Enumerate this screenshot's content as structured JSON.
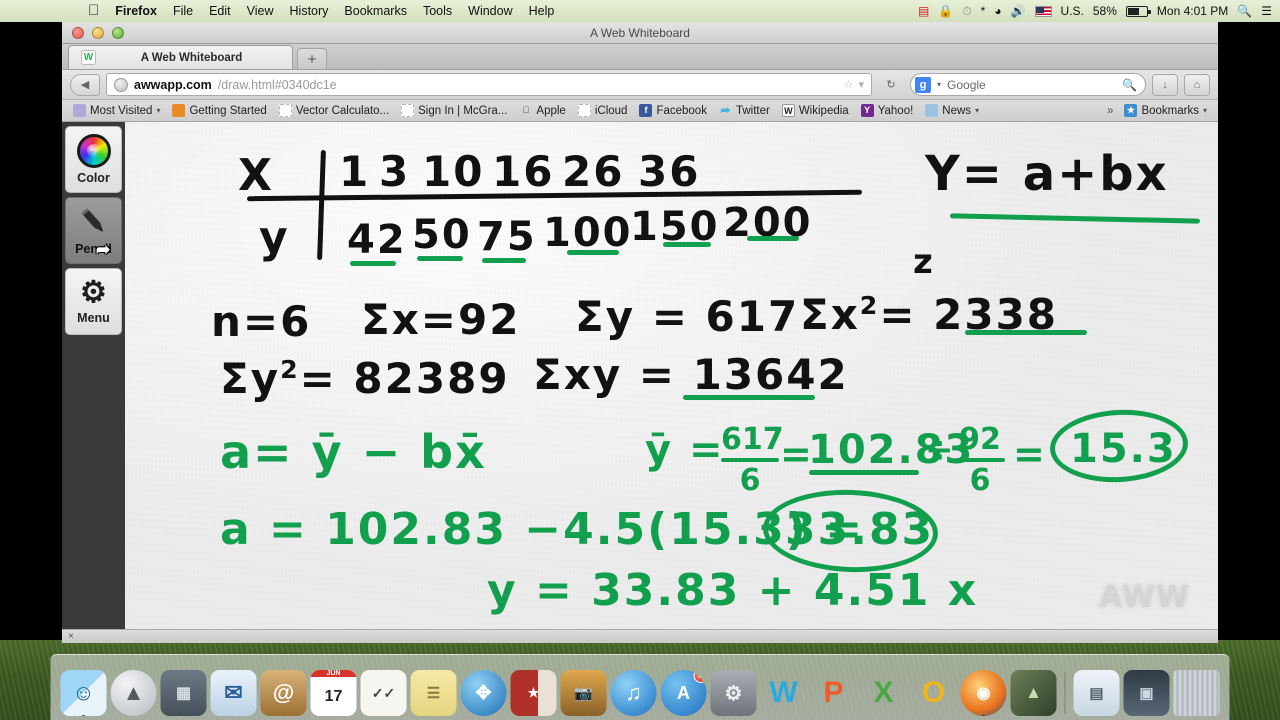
{
  "menubar": {
    "apple": "apple-logo",
    "items": [
      "Firefox",
      "File",
      "Edit",
      "View",
      "History",
      "Bookmarks",
      "Tools",
      "Window",
      "Help"
    ],
    "status": {
      "keyboard_flag": "U.S.",
      "battery": "58%",
      "clock": "Mon 4:01 PM",
      "icons": [
        "screen-recorder-icon",
        "lock-icon",
        "time-machine-icon",
        "bluetooth-icon",
        "wifi-icon",
        "volume-icon",
        "flag-icon",
        "battery-icon",
        "spotlight-icon",
        "notification-center-icon"
      ]
    }
  },
  "window": {
    "title": "A Web Whiteboard",
    "tab": {
      "label": "A Web Whiteboard",
      "favicon_letter": "W"
    },
    "new_tab": "+",
    "nav": {
      "back": "◀",
      "reload": "↻",
      "home": "⌂",
      "download": "↓",
      "url_host": "awwapp.com",
      "url_path": "/draw.html#0340dc1e",
      "bookmark_star": "☆",
      "dropdown": "▾"
    },
    "search": {
      "engine_letter": "g",
      "placeholder": "Google",
      "dropdown": "▾",
      "icon": "search-icon"
    }
  },
  "bookmarks_bar": {
    "items": [
      {
        "label": "Most Visited",
        "icon": "folder-icon",
        "has_arrow": true
      },
      {
        "label": "Getting Started",
        "icon": "firefox-icon",
        "has_arrow": false
      },
      {
        "label": "Vector Calculato...",
        "icon": "blank-page-icon",
        "has_arrow": false
      },
      {
        "label": "Sign In | McGra...",
        "icon": "blank-page-icon",
        "has_arrow": false
      },
      {
        "label": "Apple",
        "icon": "apple-icon",
        "has_arrow": false
      },
      {
        "label": "iCloud",
        "icon": "blank-page-icon",
        "has_arrow": false
      },
      {
        "label": "Facebook",
        "icon": "facebook-icon",
        "has_arrow": false
      },
      {
        "label": "Twitter",
        "icon": "twitter-icon",
        "has_arrow": false
      },
      {
        "label": "Wikipedia",
        "icon": "wikipedia-icon",
        "has_arrow": false
      },
      {
        "label": "Yahoo!",
        "icon": "yahoo-icon",
        "has_arrow": false
      },
      {
        "label": "News",
        "icon": "folder-icon",
        "has_arrow": true
      }
    ],
    "overflow": "»",
    "bookmarks_menu": {
      "label": "Bookmarks",
      "icon": "bookmarks-icon",
      "arrow": "▾"
    }
  },
  "toolpanel": {
    "tools": [
      {
        "label": "Color",
        "icon": "color-wheel-icon",
        "active": false
      },
      {
        "label": "Pencil",
        "icon": "pencil-icon",
        "active": true
      },
      {
        "label": "Menu",
        "icon": "gear-icon",
        "active": false
      }
    ],
    "cursor": "mouse-cursor-icon"
  },
  "whiteboard": {
    "watermark": "AWW",
    "table": {
      "x_label": "X",
      "y_label": "y",
      "x_values": [
        "1",
        "3",
        "10",
        "16",
        "26",
        "36"
      ],
      "y_values": [
        "42",
        "50",
        "75",
        "100",
        "150",
        "200"
      ]
    },
    "model_formula": "Y= a+bx",
    "stats": {
      "n": "n=6",
      "sum_x": "Σx=92",
      "sum_y": "Σy = 617",
      "sum_x2_label": "Σx",
      "sum_x2_sup": "2",
      "sum_x2_value": "= 2338",
      "sum_y2_label": "Σy",
      "sum_y2_sup": "2",
      "sum_y2_value": "= 82389",
      "sum_xy": "Σxy = 13642"
    },
    "work": {
      "a_formula": "a= ȳ − bx̄",
      "ybar_label": "ȳ =",
      "ybar_num": "617",
      "ybar_den": "6",
      "ybar_eq": "=",
      "ybar_value": "102.83",
      "xbar_eq": "÷",
      "xbar_num": "92",
      "xbar_den": "6",
      "xbar_result_eq": "=",
      "xbar_result": "15.3",
      "a_calc": "a = 102.83 −4.5(15.3) =",
      "a_result": "33.83",
      "final_equation": "y =  33.83 + 4.51 x",
      "stray_z": "z"
    }
  },
  "statusbar": {
    "close": "×"
  },
  "dock": {
    "icons": [
      {
        "name": "finder-icon",
        "glyph": "◑",
        "bg": "#6fb5e8",
        "running": true
      },
      {
        "name": "launchpad-icon",
        "glyph": "Ὠ0",
        "bg": "#c9ccd1",
        "running": false
      },
      {
        "name": "mission-control-icon",
        "glyph": "▦",
        "bg": "#8a8f95",
        "running": false
      },
      {
        "name": "mail-icon",
        "glyph": "✉",
        "bg": "#d9e4ef",
        "running": false
      },
      {
        "name": "contacts-icon",
        "glyph": "@",
        "bg": "#c79a5a",
        "running": false
      },
      {
        "name": "calendar-icon",
        "glyph": "17",
        "bg": "#ffffff",
        "running": false
      },
      {
        "name": "reminders-icon",
        "glyph": "✓",
        "bg": "#f2f2ee",
        "running": false
      },
      {
        "name": "notes-icon",
        "glyph": "≡",
        "bg": "#f3e6a0",
        "running": false
      },
      {
        "name": "safari-icon",
        "glyph": "☸",
        "bg": "#2f8fd8",
        "running": false
      },
      {
        "name": "imovie-icon",
        "glyph": "★",
        "bg": "#b0302a",
        "running": false
      },
      {
        "name": "iphoto-icon",
        "glyph": "◉",
        "bg": "#c89a4a",
        "running": false
      },
      {
        "name": "itunes-icon",
        "glyph": "♫",
        "bg": "#3aa0e8",
        "running": false
      },
      {
        "name": "app-store-icon",
        "glyph": "A",
        "bg": "#2b8fe0",
        "badge": "3",
        "running": false
      },
      {
        "name": "system-preferences-icon",
        "glyph": "⚙",
        "bg": "#8d9196",
        "running": false
      },
      {
        "name": "word-icon",
        "glyph": "W",
        "bg": "#2aa8e0",
        "running": false
      },
      {
        "name": "powerpoint-icon",
        "glyph": "P",
        "bg": "#ef5a28",
        "running": false
      },
      {
        "name": "excel-icon",
        "glyph": "X",
        "bg": "#4aa843",
        "running": false
      },
      {
        "name": "outlook-icon",
        "glyph": "O",
        "bg": "#f0b51c",
        "running": false
      },
      {
        "name": "firefox-icon",
        "glyph": "◕",
        "bg": "#e98a22",
        "running": true
      },
      {
        "name": "green-app-icon",
        "glyph": "▲",
        "bg": "#4b5a3a",
        "running": false
      }
    ],
    "stack_icons": [
      {
        "name": "documents-stack-icon",
        "glyph": "▤",
        "bg": "#e8eef6"
      },
      {
        "name": "downloads-stack-icon",
        "glyph": "▥",
        "bg": "#d5dde6"
      }
    ],
    "trash": {
      "name": "trash-icon",
      "glyph": "Ὕ1",
      "bg": "#cfd4d9"
    }
  }
}
